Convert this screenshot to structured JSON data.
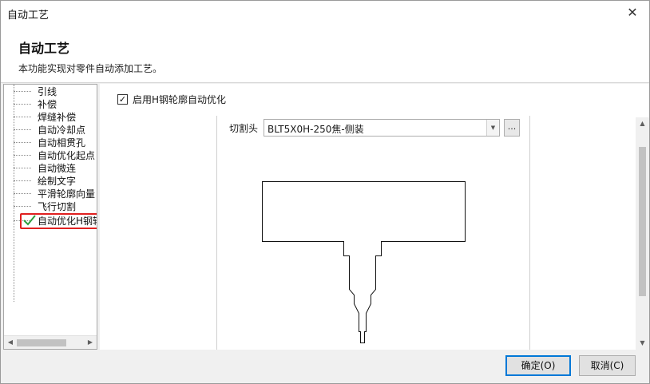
{
  "window": {
    "title": "自动工艺",
    "close_glyph": "✕"
  },
  "header": {
    "title": "自动工艺",
    "description": "本功能实现对零件自动添加工艺。"
  },
  "tree": {
    "items": [
      {
        "label": "引线"
      },
      {
        "label": "补偿"
      },
      {
        "label": "焊缝补偿"
      },
      {
        "label": "自动冷却点"
      },
      {
        "label": "自动相贯孔"
      },
      {
        "label": "自动优化起点"
      },
      {
        "label": "自动微连"
      },
      {
        "label": "绘制文字"
      },
      {
        "label": "平滑轮廓向量"
      },
      {
        "label": "飞行切割"
      },
      {
        "label": "自动优化H钢轮",
        "selected": true,
        "icon": "checkmark-icon",
        "highlight_color": "#e02020",
        "check_color": "#2e9e3e"
      }
    ]
  },
  "content": {
    "enable_checkbox": {
      "label": "启用H钢轮廓自动优化",
      "checked": true,
      "glyph": "✓"
    },
    "cut_head": {
      "label": "切割头",
      "value": "BLT5X0H-250焦-侧装",
      "more_label": "..."
    }
  },
  "scroll": {
    "left_arrow": "◀",
    "right_arrow": "▶",
    "up_arrow": "▲",
    "down_arrow": "▼",
    "dropdown_arrow": "▼"
  },
  "buttons": {
    "ok": "确定(O)",
    "cancel": "取消(C)"
  }
}
